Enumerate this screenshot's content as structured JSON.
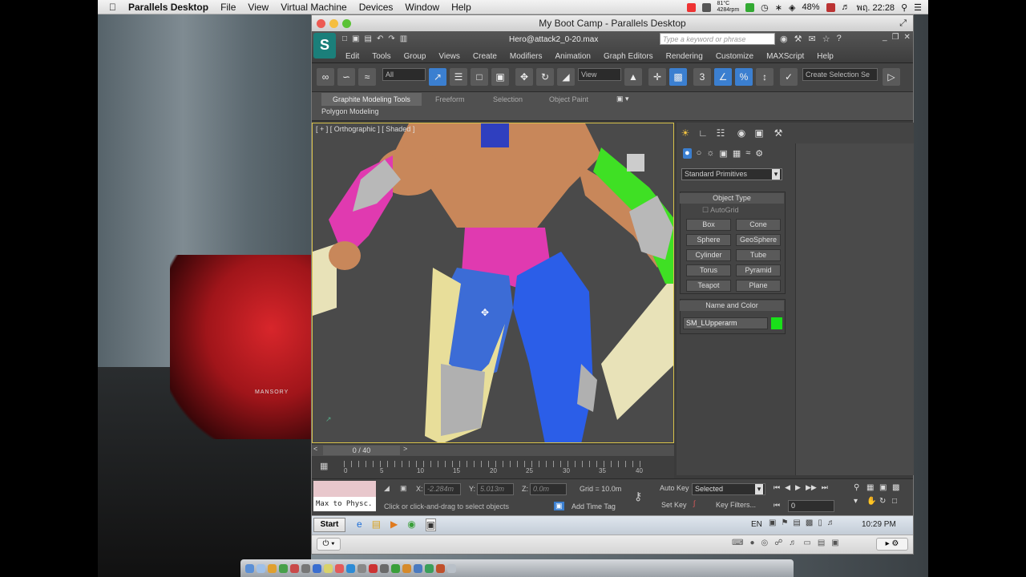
{
  "mac_menubar": {
    "apple": "",
    "app_name": "Parallels Desktop",
    "items": [
      "File",
      "View",
      "Virtual Machine",
      "Devices",
      "Window",
      "Help"
    ],
    "temp": "81°C",
    "rpm": "4284rpm",
    "battery": "48%",
    "clock": "พฤ. 22:28"
  },
  "car": {
    "brand": "MANSORY"
  },
  "window": {
    "title": "My Boot Camp - Parallels Desktop"
  },
  "max": {
    "filename": "Hero@attack2_0-20.max",
    "search_placeholder": "Type a keyword or phrase",
    "menu": [
      "Edit",
      "Tools",
      "Group",
      "Views",
      "Create",
      "Modifiers",
      "Animation",
      "Graph Editors",
      "Rendering",
      "Customize",
      "MAXScript",
      "Help"
    ],
    "toolbar": {
      "filter_value": "All",
      "refcoord_value": "View",
      "selection_set_placeholder": "Create Selection Se"
    },
    "ribbon": {
      "tabs": [
        "Graphite Modeling Tools",
        "Freeform",
        "Selection",
        "Object Paint"
      ],
      "panel": "Polygon Modeling"
    },
    "viewport_label": "[ + ] [ Orthographic ] [ Shaded ]",
    "command_panel": {
      "category": "Standard Primitives",
      "object_type_header": "Object Type",
      "autogrid": "AutoGrid",
      "buttons": [
        "Box",
        "Cone",
        "Sphere",
        "GeoSphere",
        "Cylinder",
        "Tube",
        "Torus",
        "Pyramid",
        "Teapot",
        "Plane"
      ],
      "name_color_header": "Name and Color",
      "object_name": "SM_LUpperarm",
      "object_color": "#19e019"
    },
    "timeline": {
      "frame": "0 / 40",
      "ticks": [
        "0",
        "5",
        "10",
        "15",
        "20",
        "25",
        "30",
        "35",
        "40"
      ]
    },
    "status": {
      "maxscript_text": "Max to Physc.",
      "prompt": "Click or click-and-drag to select objects",
      "x_label": "X:",
      "x_value": "-2.284m",
      "y_label": "Y:",
      "y_value": "5.013m",
      "z_label": "Z:",
      "z_value": "0.0m",
      "grid": "Grid = 10.0m",
      "add_time_tag": "Add Time Tag",
      "auto_key": "Auto Key",
      "set_key": "Set Key",
      "selected_value": "Selected",
      "key_filters": "Key Filters...",
      "frame_value": "0"
    }
  },
  "taskbar": {
    "start": "Start",
    "lang": "EN",
    "time": "10:29 PM"
  }
}
